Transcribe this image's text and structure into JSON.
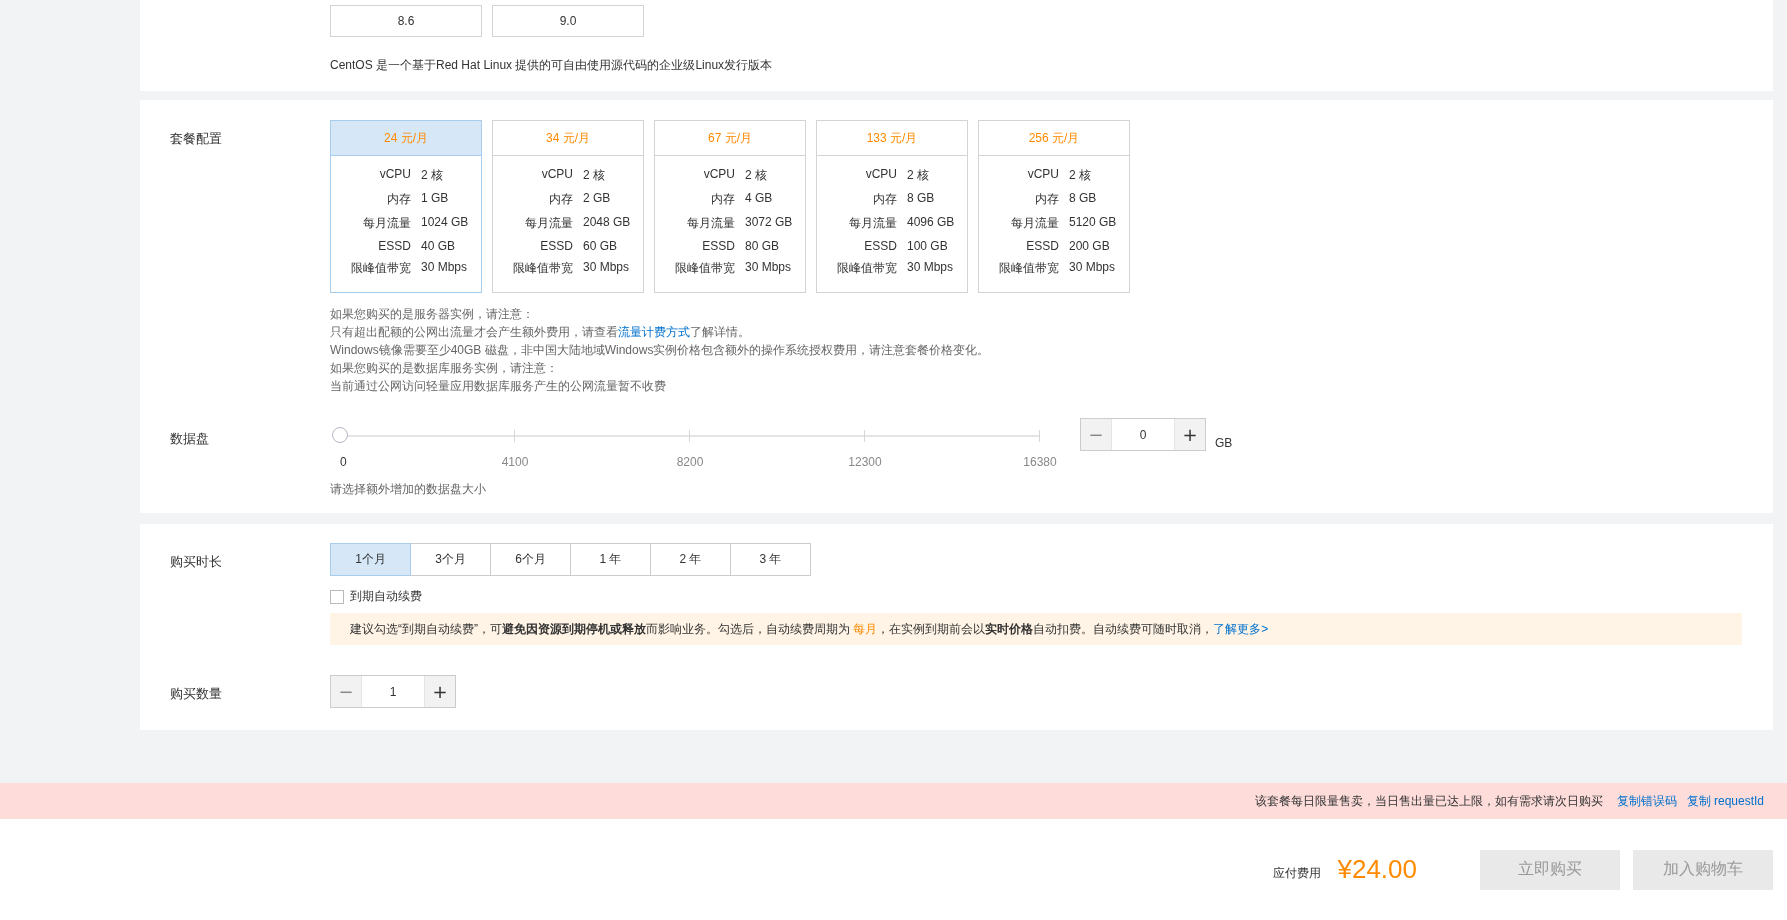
{
  "os_versions": [
    {
      "label": "8.6",
      "selected": false
    },
    {
      "label": "9.0",
      "selected": false
    }
  ],
  "os_description": "CentOS 是一个基于Red Hat Linux 提供的可自由使用源代码的企业级Linux发行版本",
  "plan": {
    "label": "套餐配置",
    "options": [
      {
        "price": "24 元/月",
        "selected": true,
        "specs": [
          {
            "name": "vCPU",
            "value": "2 核"
          },
          {
            "name": "内存",
            "value": "1 GB"
          },
          {
            "name": "每月流量",
            "value": "1024 GB"
          },
          {
            "name": "ESSD",
            "value": "40 GB"
          },
          {
            "name": "限峰值带宽",
            "value": "30 Mbps"
          }
        ]
      },
      {
        "price": "34 元/月",
        "selected": false,
        "specs": [
          {
            "name": "vCPU",
            "value": "2 核"
          },
          {
            "name": "内存",
            "value": "2 GB"
          },
          {
            "name": "每月流量",
            "value": "2048 GB"
          },
          {
            "name": "ESSD",
            "value": "60 GB"
          },
          {
            "name": "限峰值带宽",
            "value": "30 Mbps"
          }
        ]
      },
      {
        "price": "67 元/月",
        "selected": false,
        "specs": [
          {
            "name": "vCPU",
            "value": "2 核"
          },
          {
            "name": "内存",
            "value": "4 GB"
          },
          {
            "name": "每月流量",
            "value": "3072 GB"
          },
          {
            "name": "ESSD",
            "value": "80 GB"
          },
          {
            "name": "限峰值带宽",
            "value": "30 Mbps"
          }
        ]
      },
      {
        "price": "133 元/月",
        "selected": false,
        "specs": [
          {
            "name": "vCPU",
            "value": "2 核"
          },
          {
            "name": "内存",
            "value": "8 GB"
          },
          {
            "name": "每月流量",
            "value": "4096 GB"
          },
          {
            "name": "ESSD",
            "value": "100 GB"
          },
          {
            "name": "限峰值带宽",
            "value": "30 Mbps"
          }
        ]
      },
      {
        "price": "256 元/月",
        "selected": false,
        "specs": [
          {
            "name": "vCPU",
            "value": "2 核"
          },
          {
            "name": "内存",
            "value": "8 GB"
          },
          {
            "name": "每月流量",
            "value": "5120 GB"
          },
          {
            "name": "ESSD",
            "value": "200 GB"
          },
          {
            "name": "限峰值带宽",
            "value": "30 Mbps"
          }
        ]
      }
    ],
    "notes": [
      [
        {
          "kind": "text",
          "text": "如果您购买的是服务器实例，请注意："
        }
      ],
      [
        {
          "kind": "text",
          "text": "只有超出配额的公网出流量才会产生额外费用，请查看"
        },
        {
          "kind": "link",
          "text": "流量计费方式"
        },
        {
          "kind": "text",
          "text": "了解详情。"
        }
      ],
      [
        {
          "kind": "text",
          "text": "Windows镜像需要至少40GB 磁盘，非中国大陆地域Windows实例价格包含额外的操作系统授权费用，请注意套餐价格变化。"
        }
      ],
      [
        {
          "kind": "text",
          "text": "如果您购买的是数据库服务实例，请注意："
        }
      ],
      [
        {
          "kind": "text",
          "text": "当前通过公网访问轻量应用数据库服务产生的公网流量暂不收费"
        }
      ]
    ]
  },
  "data_disk": {
    "label": "数据盘",
    "level": 0,
    "ticks": [
      "0",
      "4100",
      "8200",
      "12300",
      "16380"
    ],
    "stepper": {
      "minus": "−",
      "minus_disabled": true,
      "value": "0",
      "plus": "+"
    },
    "unit": "GB",
    "hint": "请选择额外增加的数据盘大小"
  },
  "duration": {
    "label": "购买时长",
    "options": [
      {
        "label": "1个月",
        "selected": true
      },
      {
        "label": "3个月",
        "selected": false
      },
      {
        "label": "6个月",
        "selected": false
      },
      {
        "label": "1 年",
        "selected": false
      },
      {
        "label": "2 年",
        "selected": false
      },
      {
        "label": "3 年",
        "selected": false
      }
    ],
    "auto_renew": {
      "label": "到期自动续费",
      "checked": false
    },
    "notice": [
      {
        "kind": "text",
        "text": "建议勾选“到期自动续费”，可**避免因资源到期停机或释放**而影响业务。勾选后，自动续费周期为 "
      },
      {
        "kind": "highlight",
        "text": "每月"
      },
      {
        "kind": "text",
        "text": "，在实例到期前会以**实时价格**自动扣费。自动续费可随时取消，"
      },
      {
        "kind": "link",
        "text": "了解更多>"
      }
    ]
  },
  "quantity": {
    "label": "购买数量",
    "stepper": {
      "minus": "−",
      "minus_disabled": true,
      "value": "1",
      "plus": "+"
    }
  },
  "error_bar": {
    "message": "该套餐每日限量售卖，当日售出量已达上限，如有需求请次日购买",
    "links": [
      "复制错误码",
      "复制 requestId"
    ]
  },
  "footer": {
    "price_label": "应付费用",
    "price": "¥24.00",
    "buttons": [
      {
        "label": "立即购买",
        "disabled": true
      },
      {
        "label": "加入购物车",
        "disabled": true
      }
    ]
  }
}
